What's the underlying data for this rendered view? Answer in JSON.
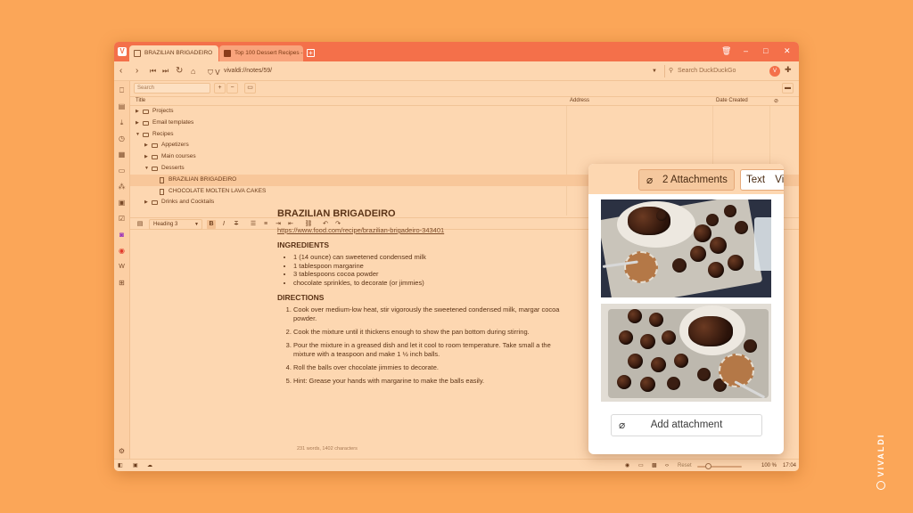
{
  "browser": {
    "tabs": [
      {
        "label": "BRAZILIAN BRIGADEIRO",
        "active": true
      },
      {
        "label": "Top 100 Dessert Recipes -",
        "active": false
      }
    ],
    "url": "vivaldi://notes/59/",
    "search_placeholder": "Search DuckDuckGo",
    "accent_color": "#F4704A"
  },
  "notes": {
    "search_placeholder": "Search",
    "columns": {
      "title": "Title",
      "address": "Address",
      "date": "Date Created"
    },
    "tree": [
      {
        "label": "Projects",
        "type": "folder",
        "level": 0,
        "expanded": false
      },
      {
        "label": "Email templates",
        "type": "folder",
        "level": 0,
        "expanded": false
      },
      {
        "label": "Recipes",
        "type": "folder",
        "level": 0,
        "expanded": true
      },
      {
        "label": "Appetizers",
        "type": "folder",
        "level": 1,
        "expanded": false
      },
      {
        "label": "Main courses",
        "type": "folder",
        "level": 1,
        "expanded": false
      },
      {
        "label": "Desserts",
        "type": "folder",
        "level": 1,
        "expanded": true
      },
      {
        "label": "BRAZILIAN BRIGADEIRO",
        "type": "note",
        "level": 2,
        "selected": true
      },
      {
        "label": "CHOCOLATE MOLTEN LAVA CAKES",
        "type": "note",
        "level": 2
      },
      {
        "label": "Drinks and Cocktails",
        "type": "folder",
        "level": 1,
        "expanded": false
      }
    ],
    "counts": {
      "brigadeiro": "2",
      "lava": "1"
    }
  },
  "editor": {
    "heading_select": "Heading 3",
    "visual_label": "ual",
    "title": "BRAZILIAN BRIGADEIRO",
    "link": "https://www.food.com/recipe/brazilian-brigadeiro-343401",
    "ingredients_heading": "INGREDIENTS",
    "ingredients": [
      "1 (14 ounce) can sweetened condensed milk",
      "1 tablespoon margarine",
      "3 tablespoons cocoa powder",
      "chocolate sprinkles, to decorate (or jimmies)"
    ],
    "directions_heading": "DIRECTIONS",
    "directions": [
      "Cook over medium-low heat, stir vigorously the sweetened condensed milk, margar cocoa powder.",
      "Cook the mixture until it thickens enough to show the pan bottom during stirring.",
      "Pour the mixture in a greased dish and let it cool to room temperature. Take small a the mixture with a teaspoon and make 1 ½ inch balls.",
      "Roll the balls over chocolate jimmies to decorate.",
      "Hint: Grease your hands with margarine to make the balls easily."
    ],
    "word_count": "231 words, 1402 characters"
  },
  "popup": {
    "attachments_label": "2 Attachments",
    "tab_text": "Text",
    "tab_visual": "Vi",
    "add_label": "Add attachment"
  },
  "status": {
    "reset_label": "Reset",
    "zoom": "100 %",
    "time": "17:04"
  },
  "watermark": "VIVALDI"
}
